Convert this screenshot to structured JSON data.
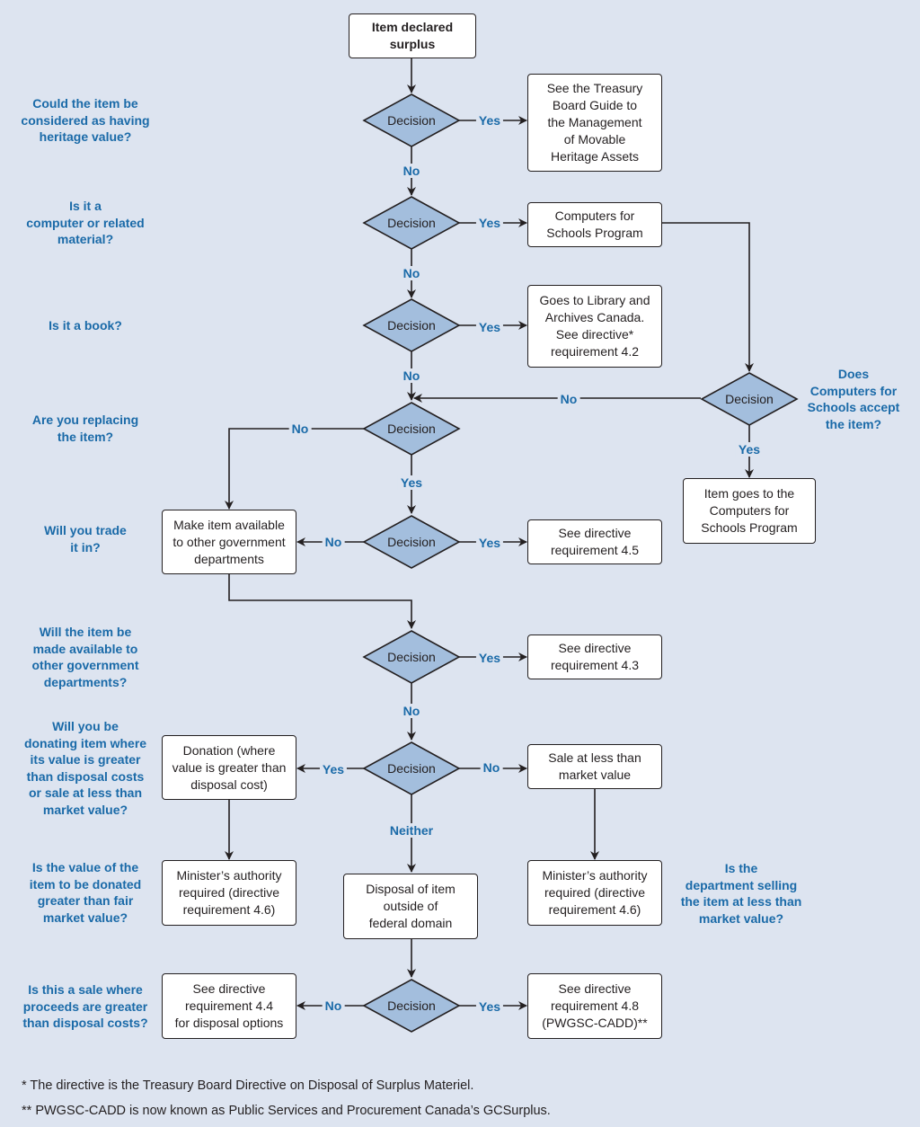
{
  "colors": {
    "background": "#dde4f0",
    "question_text": "#1a6aa8",
    "decision_fill": "#a3bedd",
    "stroke": "#231f20",
    "box_fill": "#ffffff"
  },
  "start": "Item declared\nsurplus",
  "decision_label": "Decision",
  "questions": {
    "heritage": "Could the item be\nconsidered as having\nheritage value?",
    "computer": "Is it a\ncomputer or related\nmaterial?",
    "book": "Is it a book?",
    "replacing": "Are you replacing\nthe item?",
    "trade": "Will you trade\nit in?",
    "ogd": "Will the item be\nmade available to\nother government\ndepartments?",
    "donating": "Will you be\ndonating item where\nits value is greater\nthan disposal costs\nor sale at less than\nmarket value?",
    "donated_value": "Is the value of the\nitem to be donated\ngreater than fair\nmarket value?",
    "sale_proceeds": "Is this a sale where\nproceeds are greater\nthan disposal costs?",
    "cfs_accept": "Does\nComputers for\nSchools accept\nthe item?",
    "selling_less": "Is the\ndepartment selling\nthe item at less than\nmarket value?"
  },
  "boxes": {
    "heritage_guide": "See the Treasury\nBoard Guide to\nthe Management\nof Movable\nHeritage Assets",
    "cfs_program": "Computers for\nSchools Program",
    "library": "Goes to Library and\nArchives Canada.\nSee directive*\nrequirement 4.2",
    "cfs_item": "Item goes to the\nComputers for\nSchools Program",
    "make_available": "Make item available\nto other government\ndepartments",
    "req_4_5": "See directive\nrequirement 4.5",
    "req_4_3": "See directive\nrequirement 4.3",
    "donation": "Donation (where\nvalue is greater than\ndisposal cost)",
    "sale_less": "Sale at less than\nmarket value",
    "minister_left": "Minister’s authority\nrequired (directive\nrequirement 4.6)",
    "disposal_outside": "Disposal of item\noutside of\nfederal domain",
    "minister_right": "Minister’s authority\nrequired (directive\nrequirement 4.6)",
    "req_4_4": "See directive\nrequirement 4.4\nfor disposal options",
    "req_4_8": "See directive\nrequirement 4.8\n(PWGSC-CADD)**"
  },
  "edge_labels": {
    "yes": "Yes",
    "no": "No",
    "neither": "Neither"
  },
  "footnotes": [
    "*  The directive is the Treasury Board Directive on Disposal of Surplus Materiel.",
    "** PWGSC-CADD is now known as Public Services and Procurement Canada’s GCSurplus."
  ]
}
